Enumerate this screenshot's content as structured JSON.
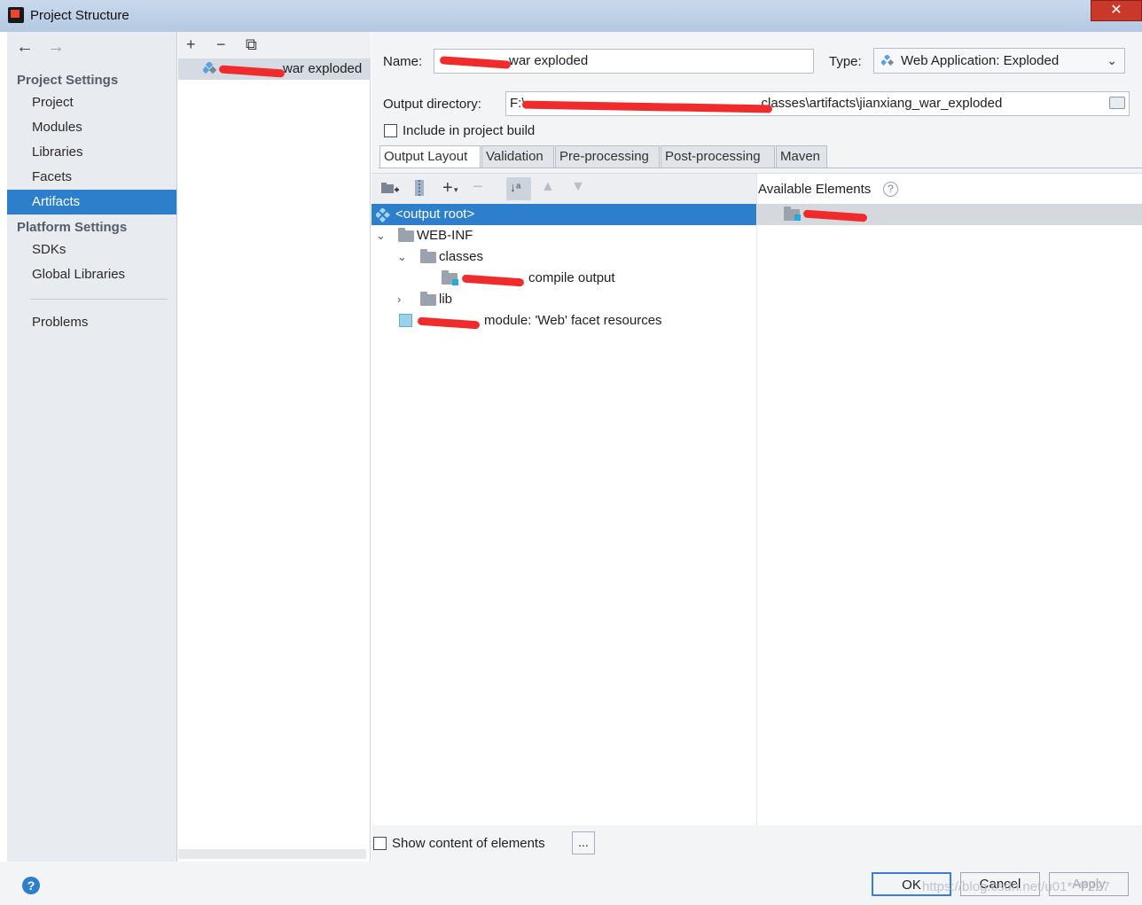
{
  "window": {
    "title": "Project Structure",
    "close_glyph": "✕"
  },
  "nav": {
    "back_icon": "←",
    "forward_icon": "→",
    "project_settings_heading": "Project Settings",
    "project_settings_items": [
      "Project",
      "Modules",
      "Libraries",
      "Facets",
      "Artifacts"
    ],
    "selected_item": "Artifacts",
    "platform_settings_heading": "Platform Settings",
    "platform_settings_items": [
      "SDKs",
      "Global Libraries"
    ],
    "problems_label": "Problems"
  },
  "artifacts": {
    "toolbar": {
      "add": "+",
      "remove": "−",
      "copy": "⧉"
    },
    "list": [
      {
        "label": "war exploded",
        "label_redacted_prefix": true
      }
    ]
  },
  "form": {
    "name_label": "Name:",
    "name_value": "war exploded",
    "type_label": "Type:",
    "type_value": "Web Application: Exploded",
    "output_dir_label": "Output directory:",
    "output_dir_value": "F:\\",
    "output_dir_value_suffix": "classes\\artifacts\\jianxiang_war_exploded",
    "include_in_build_label": "Include in project build",
    "include_in_build_checked": false
  },
  "tabs": [
    "Output Layout",
    "Validation",
    "Pre-processing",
    "Post-processing",
    "Maven"
  ],
  "active_tab": "Output Layout",
  "output_tree": [
    {
      "label": "<output root>",
      "selected": true,
      "icon": "artifact-icon"
    },
    {
      "label": "WEB-INF",
      "expanded": true,
      "icon": "folder-icon"
    },
    {
      "label": "classes",
      "expanded": true,
      "icon": "folder-icon"
    },
    {
      "label": "compile output",
      "icon": "module-output-icon"
    },
    {
      "label": "lib",
      "expanded": false,
      "icon": "folder-icon"
    },
    {
      "label": "module: 'Web' facet resources",
      "icon": "web-facet-icon"
    }
  ],
  "available": {
    "title": "Available Elements",
    "help_glyph": "?",
    "items": [
      {
        "label": "",
        "icon": "module-folder-icon"
      }
    ]
  },
  "bottom": {
    "show_content_label": "Show content of elements",
    "show_content_checked": false,
    "ellipsis_label": "..."
  },
  "footer": {
    "help_glyph": "?",
    "ok_label": "OK",
    "cancel_label": "Cancel",
    "apply_label": "Apply",
    "watermark": "https://blog.csdn.net/u01****227"
  },
  "colors": {
    "selection": "#2d7fcb",
    "redaction": "#ef2b2b"
  }
}
